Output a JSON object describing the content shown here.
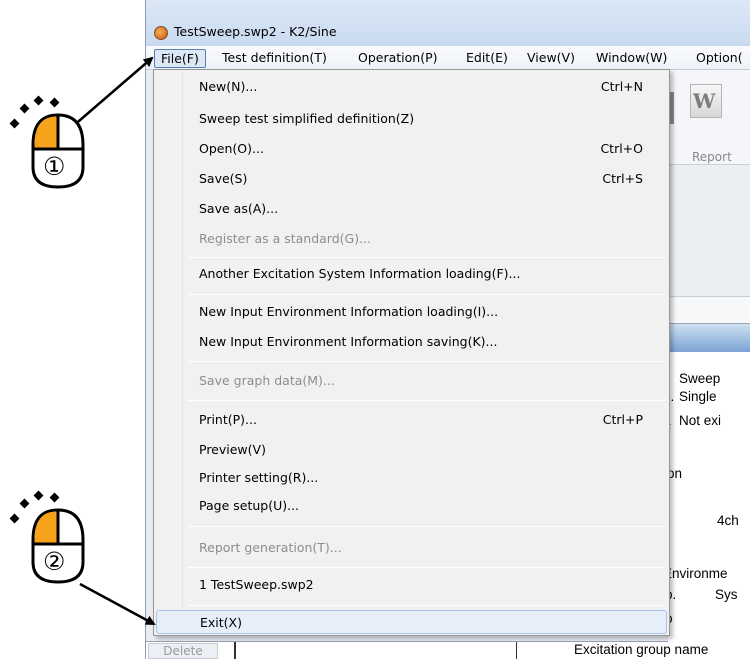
{
  "window": {
    "title": "TestSweep.swp2 - K2/Sine"
  },
  "menubar": {
    "items": [
      {
        "label": "File(F)",
        "active": true
      },
      {
        "label": "Test definition(T)"
      },
      {
        "label": "Operation(P)"
      },
      {
        "label": "Edit(E)"
      },
      {
        "label": "View(V)"
      },
      {
        "label": "Window(W)"
      },
      {
        "label": "Option("
      }
    ]
  },
  "file_menu": {
    "items": [
      {
        "label": "New(N)...",
        "shortcut": "Ctrl+N"
      },
      {
        "label": "Sweep test simplified definition(Z)",
        "shortcut": ""
      },
      {
        "label": "Open(O)...",
        "shortcut": "Ctrl+O"
      },
      {
        "label": "Save(S)",
        "shortcut": "Ctrl+S"
      },
      {
        "label": "Save as(A)...",
        "shortcut": ""
      },
      {
        "label": "Register as a standard(G)...",
        "shortcut": "",
        "disabled": true
      },
      {
        "label": "Another Excitation System Information loading(F)...",
        "shortcut": ""
      },
      {
        "label": "New Input Environment Information loading(I)...",
        "shortcut": ""
      },
      {
        "label": "New Input Environment Information saving(K)...",
        "shortcut": ""
      },
      {
        "label": "Save graph data(M)...",
        "shortcut": "",
        "disabled": true
      },
      {
        "label": "Print(P)...",
        "shortcut": "Ctrl+P"
      },
      {
        "label": "Preview(V)",
        "shortcut": ""
      },
      {
        "label": "Printer setting(R)...",
        "shortcut": ""
      },
      {
        "label": "Page setup(U)...",
        "shortcut": ""
      },
      {
        "label": "Report generation(T)...",
        "shortcut": "",
        "disabled": true
      },
      {
        "label": "1 TestSweep.swp2",
        "shortcut": ""
      },
      {
        "label": "Exit(X)",
        "shortcut": "",
        "highlighted": true
      }
    ]
  },
  "toolbar": {
    "report_label": "Report",
    "word_glyph": "W"
  },
  "background_panel": {
    "lines": [
      "Sweep",
      "g.",
      "Single",
      "a",
      "Not exi",
      "on",
      "4ch",
      "Environme",
      "o.",
      "Sys",
      "o"
    ]
  },
  "bottom_strip": {
    "delete_label": "Delete",
    "excitation_group_label": "Excitation group name"
  },
  "callouts": {
    "step1": "①",
    "step2": "②"
  },
  "colors": {
    "mouse_button": "#f7a21b",
    "menu_highlight": "#e6eef9",
    "disabled_text": "#8d8d8d"
  }
}
